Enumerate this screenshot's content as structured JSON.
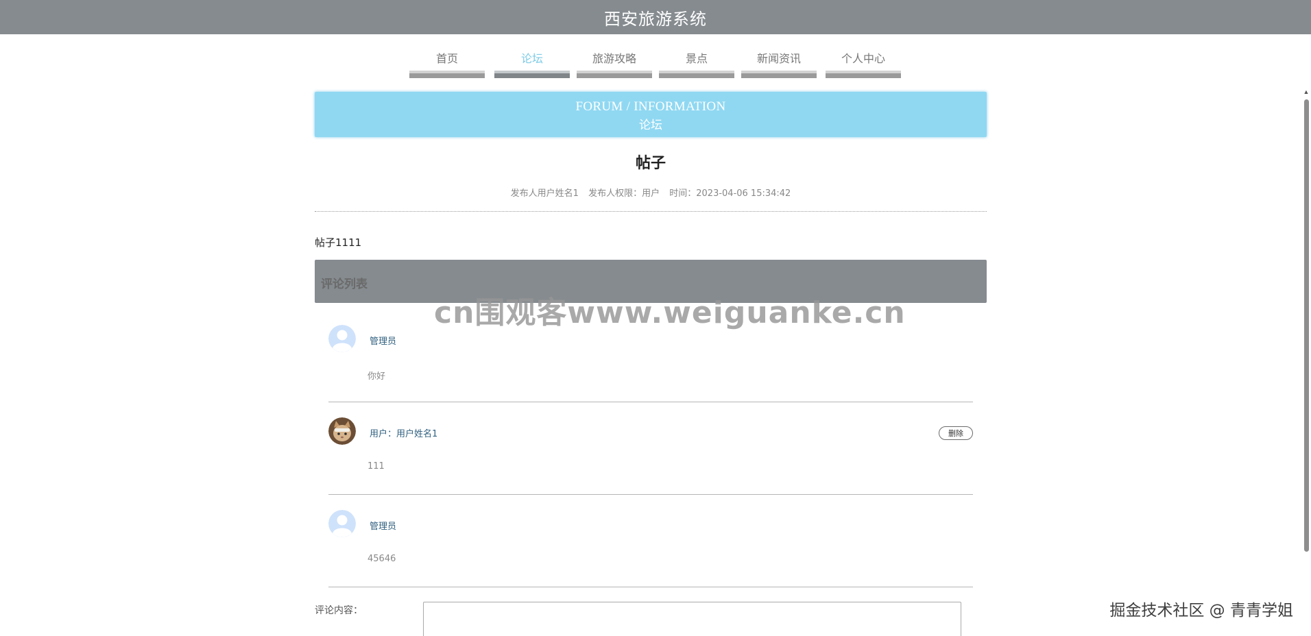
{
  "header": {
    "title": "西安旅游系统"
  },
  "nav": {
    "items": [
      {
        "label": "首页"
      },
      {
        "label": "论坛"
      },
      {
        "label": "旅游攻略"
      },
      {
        "label": "景点"
      },
      {
        "label": "新闻资讯"
      },
      {
        "label": "个人中心"
      }
    ],
    "active_index": 1
  },
  "banner": {
    "en": "FORUM / INFORMATION",
    "cn": "论坛"
  },
  "post": {
    "title": "帖子",
    "meta": {
      "author": "发布人用户姓名1",
      "role": "发布人权限：用户",
      "time": "时间：2023-04-06 15:34:42"
    },
    "content": "帖子1111"
  },
  "comments": {
    "header": "评论列表",
    "items": [
      {
        "user": "管理员",
        "text": "你好",
        "avatar": "default-avatar-icon"
      },
      {
        "user": "用户：用户姓名1",
        "text": "111",
        "avatar": "cat-avatar-photo",
        "delete_label": "删除"
      },
      {
        "user": "管理员",
        "text": "45646",
        "avatar": "default-avatar-icon"
      }
    ]
  },
  "comment_form": {
    "label": "评论内容："
  },
  "watermark": "cn围观客www.weiguanke.cn",
  "corner_watermark": "掘金技术社区 @ 青青学姐",
  "colors": {
    "topbar": "#858b8f",
    "nav_active": "#7ecbe6",
    "banner": "#90d8f2",
    "user_link": "#2f5f7f"
  }
}
